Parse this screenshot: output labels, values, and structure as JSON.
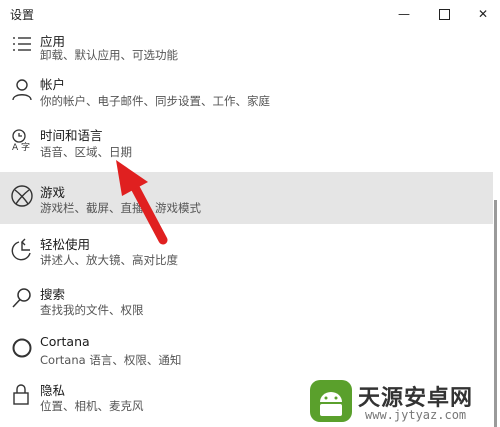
{
  "window": {
    "title": "设置",
    "minimize": "—",
    "close": "✕"
  },
  "items": [
    {
      "label": "应用",
      "desc": "卸载、默认应用、可选功能",
      "icon": "apps-list-icon"
    },
    {
      "label": "帐户",
      "desc": "你的帐户、电子邮件、同步设置、工作、家庭",
      "icon": "person-icon"
    },
    {
      "label": "时间和语言",
      "desc": "语音、区域、日期",
      "icon": "time-language-icon"
    },
    {
      "label": "游戏",
      "desc": "游戏栏、截屏、直播、游戏模式",
      "icon": "xbox-icon",
      "selected": true
    },
    {
      "label": "轻松使用",
      "desc": "讲述人、放大镜、高对比度",
      "icon": "ease-of-access-icon"
    },
    {
      "label": "搜索",
      "desc": "查找我的文件、权限",
      "icon": "search-icon"
    },
    {
      "label": "Cortana",
      "desc": "Cortana 语言、权限、通知",
      "icon": "cortana-icon"
    },
    {
      "label": "隐私",
      "desc": "位置、相机、麦克风",
      "icon": "lock-icon"
    }
  ],
  "watermark": {
    "title": "天源安卓网",
    "url": "www.jytyaz.com"
  },
  "colors": {
    "selected_bg": "#e5e5e5",
    "arrow": "#e02020"
  }
}
